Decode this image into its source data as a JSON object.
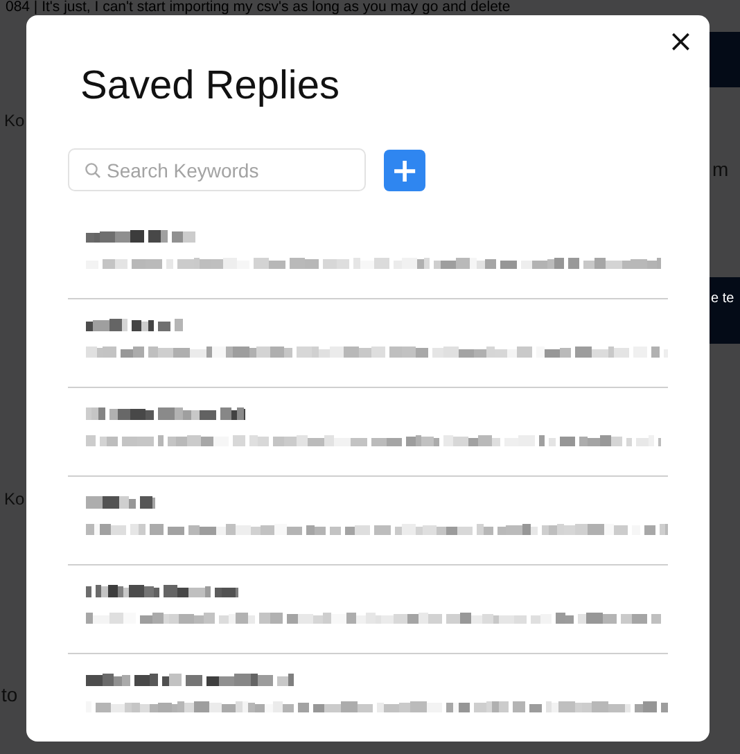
{
  "background": {
    "message_line": "084 | It's just, I can't start importing my csv's as long as you may go and delete",
    "fragments": [
      "Ko",
      "m",
      "e te",
      "Ko",
      "to"
    ]
  },
  "dialog": {
    "title": "Saved Replies",
    "close": "×",
    "search": {
      "placeholder": "Search Keywords"
    },
    "add_button": "+",
    "replies": [
      {
        "kind": "redacted"
      },
      {
        "kind": "redacted"
      },
      {
        "kind": "redacted"
      },
      {
        "kind": "redacted"
      },
      {
        "kind": "redacted"
      },
      {
        "kind": "redacted"
      }
    ]
  }
}
